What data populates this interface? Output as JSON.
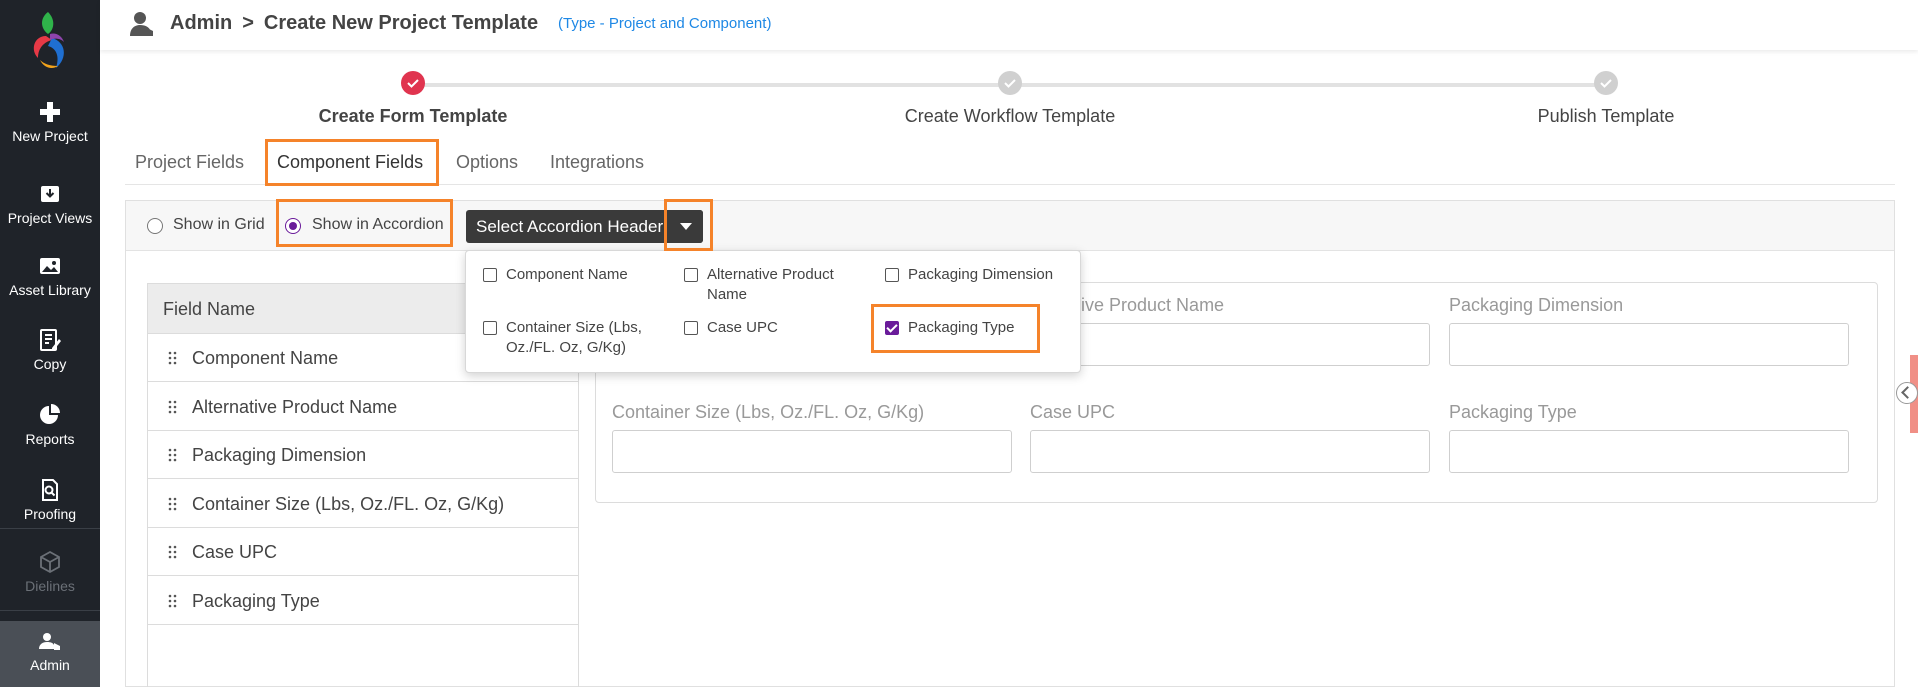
{
  "sidebar": {
    "items": [
      {
        "label": "New Project",
        "icon": "plus-icon"
      },
      {
        "label": "Project Views",
        "icon": "inbox-icon"
      },
      {
        "label": "Asset Library",
        "icon": "image-icon"
      },
      {
        "label": "Copy",
        "icon": "edit-icon"
      },
      {
        "label": "Reports",
        "icon": "pie-chart-icon"
      },
      {
        "label": "Proofing",
        "icon": "proof-search-icon"
      },
      {
        "label": "Dielines",
        "icon": "cube-icon",
        "disabled": true
      },
      {
        "label": "Admin",
        "icon": "admin-user-icon",
        "active": true
      }
    ]
  },
  "header": {
    "breadcrumb_root": "Admin",
    "breadcrumb_sep": ">",
    "breadcrumb_page": "Create New Project Template",
    "template_type": "(Type - Project and Component)"
  },
  "stepper": {
    "steps": [
      {
        "label": "Create Form Template",
        "state": "current"
      },
      {
        "label": "Create Workflow Template",
        "state": "pending"
      },
      {
        "label": "Publish Template",
        "state": "pending"
      }
    ]
  },
  "tabs": [
    {
      "label": "Project Fields"
    },
    {
      "label": "Component Fields",
      "active": true
    },
    {
      "label": "Options"
    },
    {
      "label": "Integrations"
    }
  ],
  "display_mode": {
    "grid_label": "Show in Grid",
    "accordion_label": "Show in Accordion",
    "selected": "accordion"
  },
  "accordion_header": {
    "button_label": "Select Accordion Header",
    "options": [
      {
        "label": "Component Name",
        "checked": false
      },
      {
        "label": "Alternative Product Name",
        "checked": false
      },
      {
        "label": "Packaging Dimension",
        "checked": false
      },
      {
        "label": "Container Size (Lbs, Oz./FL. Oz, G/Kg)",
        "checked": false
      },
      {
        "label": "Case UPC",
        "checked": false
      },
      {
        "label": "Packaging Type",
        "checked": true
      }
    ]
  },
  "field_table": {
    "header": "Field Name",
    "rows": [
      "Component Name",
      "Alternative Product Name",
      "Packaging Dimension",
      "Container Size (Lbs, Oz./FL. Oz, G/Kg)",
      "Case UPC",
      "Packaging Type"
    ]
  },
  "preview": {
    "fields": [
      {
        "label": "Alternative Product Name",
        "visible_label": "ative Product Name"
      },
      {
        "label": "Packaging Dimension"
      },
      {
        "label": "Container Size (Lbs, Oz./FL. Oz, G/Kg)"
      },
      {
        "label": "Case UPC"
      },
      {
        "label": "Packaging Type"
      }
    ]
  },
  "colors": {
    "accent_purple": "#6a1b9a",
    "highlight_orange": "#f5832a",
    "step_current": "#e0344f",
    "link_blue": "#1e88e5",
    "sidebar_bg": "#1f2329"
  }
}
